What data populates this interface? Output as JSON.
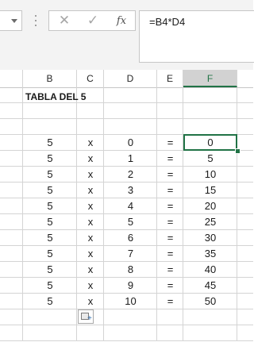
{
  "formula_bar": {
    "cancel_icon": "✕",
    "enter_icon": "✓",
    "fx_label": "fx",
    "formula": "=B4*D4"
  },
  "columns": [
    {
      "label": "B",
      "selected": false
    },
    {
      "label": "C",
      "selected": false
    },
    {
      "label": "D",
      "selected": false
    },
    {
      "label": "E",
      "selected": false
    },
    {
      "label": "F",
      "selected": true
    }
  ],
  "sheet": {
    "title": "TABLA DEL 5",
    "rows": [
      {
        "b": "5",
        "c": "x",
        "d": "0",
        "e": "=",
        "f": "0"
      },
      {
        "b": "5",
        "c": "x",
        "d": "1",
        "e": "=",
        "f": "5"
      },
      {
        "b": "5",
        "c": "x",
        "d": "2",
        "e": "=",
        "f": "10"
      },
      {
        "b": "5",
        "c": "x",
        "d": "3",
        "e": "=",
        "f": "15"
      },
      {
        "b": "5",
        "c": "x",
        "d": "4",
        "e": "=",
        "f": "20"
      },
      {
        "b": "5",
        "c": "x",
        "d": "5",
        "e": "=",
        "f": "25"
      },
      {
        "b": "5",
        "c": "x",
        "d": "6",
        "e": "=",
        "f": "30"
      },
      {
        "b": "5",
        "c": "x",
        "d": "7",
        "e": "=",
        "f": "35"
      },
      {
        "b": "5",
        "c": "x",
        "d": "8",
        "e": "=",
        "f": "40"
      },
      {
        "b": "5",
        "c": "x",
        "d": "9",
        "e": "=",
        "f": "45"
      },
      {
        "b": "5",
        "c": "x",
        "d": "10",
        "e": "=",
        "f": "50"
      }
    ]
  },
  "colors": {
    "accent": "#217346",
    "gridline": "#d4d4d4",
    "formula_bar_bg": "#f3f3f3"
  },
  "icons": {
    "namebox_dropdown": "chevron-down-icon",
    "cancel": "close-icon",
    "enter": "check-icon",
    "function": "fx-icon",
    "autofill": "auto-fill-options-icon"
  }
}
